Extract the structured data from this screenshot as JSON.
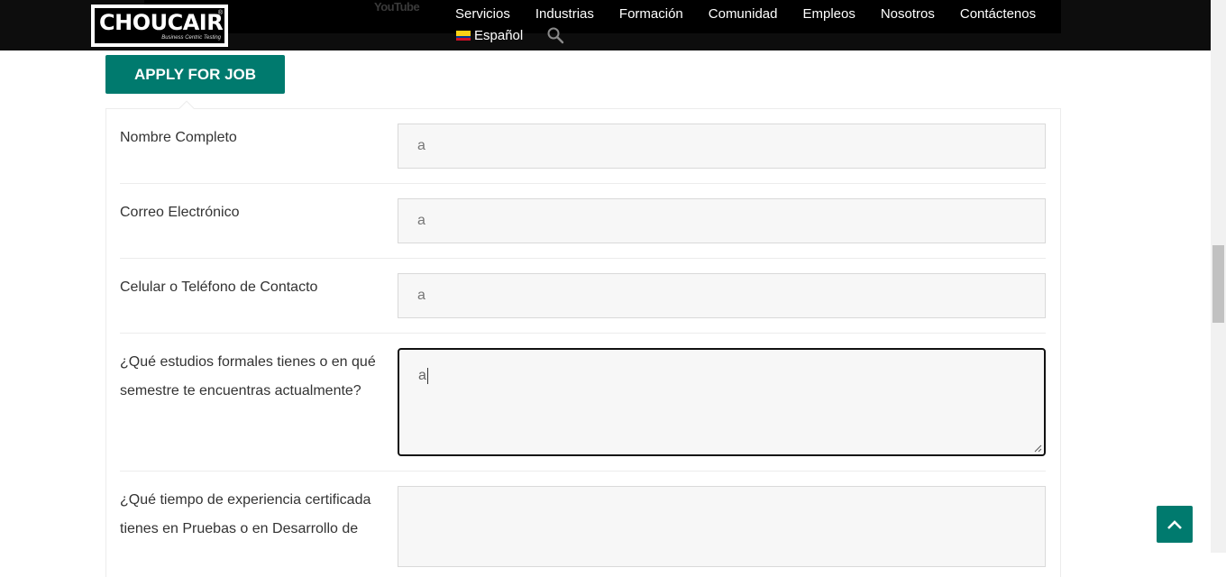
{
  "header": {
    "logo_text": "CHOUCAIR",
    "logo_tagline": "Business Centric Testing",
    "logo_reg": "®",
    "youtube_ghost": "YouTube",
    "nav": [
      "Servicios",
      "Industrias",
      "Formación",
      "Comunidad",
      "Empleos",
      "Nosotros",
      "Contáctenos"
    ],
    "language": "Español",
    "flag_colors": [
      "#fcd116",
      "#003893",
      "#ce1126"
    ]
  },
  "apply_button": {
    "label": "APPLY FOR JOB",
    "color": "#007a6e"
  },
  "form": {
    "fields": [
      {
        "label": "Nombre Completo",
        "value": "a",
        "type": "text"
      },
      {
        "label": "Correo Electrónico",
        "value": "a",
        "type": "text"
      },
      {
        "label": "Celular o Teléfono de Contacto",
        "value": "a",
        "type": "text"
      },
      {
        "label": "¿Qué estudios formales tienes o en qué semestre te encuentras actualmente?",
        "value": "a",
        "type": "textarea",
        "focused": true
      },
      {
        "label": "¿Qué tiempo de experiencia certificada tienes en Pruebas o en Desarrollo de",
        "value": "",
        "type": "textarea"
      }
    ]
  },
  "back_to_top": {
    "icon": "chevron-up-icon",
    "color": "#007a6e"
  }
}
